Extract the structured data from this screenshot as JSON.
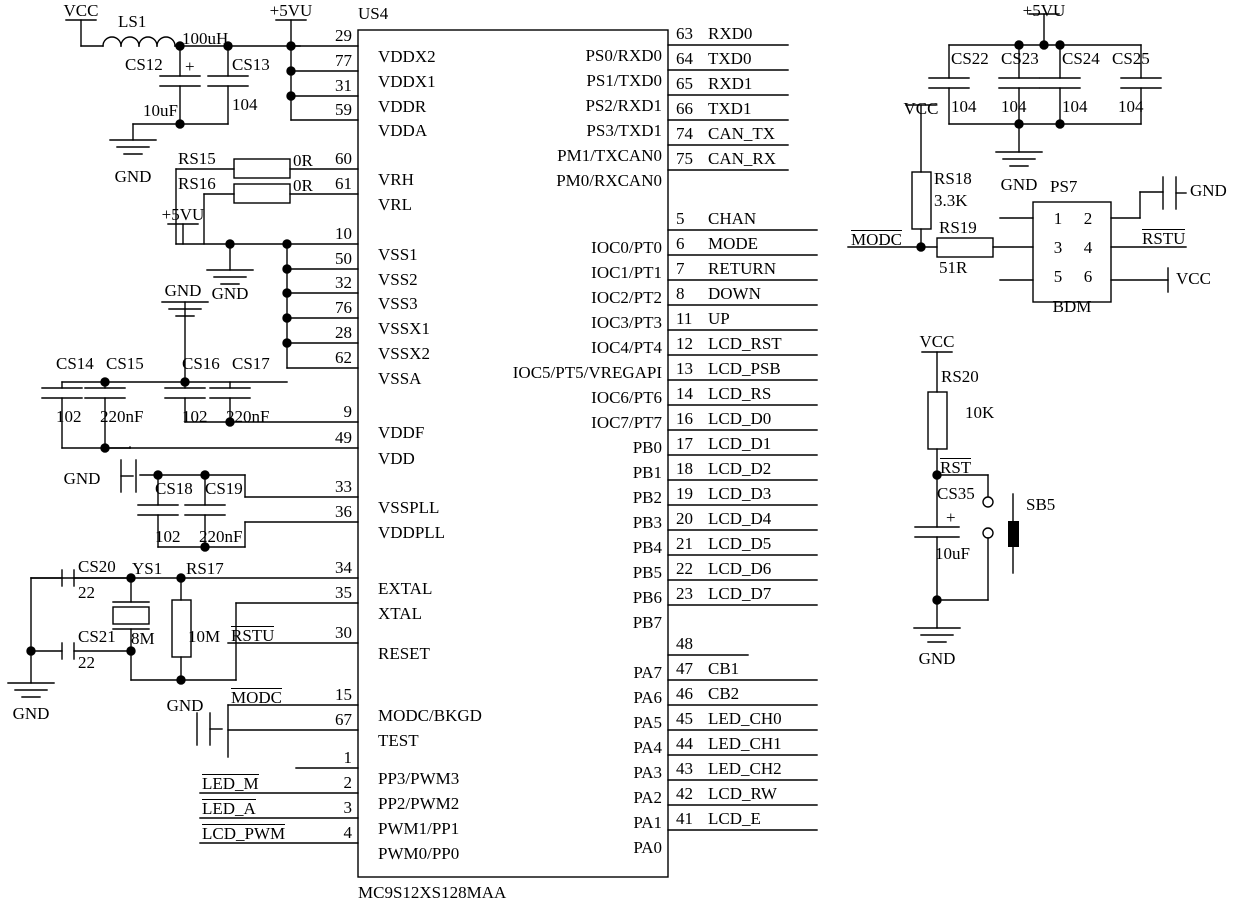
{
  "title": "MC9S12XS128MAA microcontroller schematic",
  "main_ic": {
    "ref": "US4",
    "part": "MC9S12XS128MAA",
    "left_pins": [
      {
        "num": "29",
        "name": "VDDX2"
      },
      {
        "num": "77",
        "name": "VDDX1"
      },
      {
        "num": "31",
        "name": "VDDR"
      },
      {
        "num": "59",
        "name": "VDDA"
      },
      {
        "num": "60",
        "name": "VRH"
      },
      {
        "num": "61",
        "name": "VRL"
      },
      {
        "num": "10",
        "name": "VSS1"
      },
      {
        "num": "50",
        "name": "VSS2"
      },
      {
        "num": "32",
        "name": "VSS3"
      },
      {
        "num": "76",
        "name": "VSSX1"
      },
      {
        "num": "28",
        "name": "VSSX2"
      },
      {
        "num": "62",
        "name": "VSSA"
      },
      {
        "num": "9",
        "name": "VDDF"
      },
      {
        "num": "49",
        "name": "VDD"
      },
      {
        "num": "33",
        "name": "VSSPLL"
      },
      {
        "num": "36",
        "name": "VDDPLL"
      },
      {
        "num": "34",
        "name": "EXTAL"
      },
      {
        "num": "35",
        "name": "XTAL"
      },
      {
        "num": "30",
        "name": "RESET",
        "overline": true,
        "net": "RSTU"
      },
      {
        "num": "15",
        "name": "MODC/BKGD",
        "net": "MODC"
      },
      {
        "num": "67",
        "name": "TEST"
      },
      {
        "num": "1",
        "name": "PP3/PWM3"
      },
      {
        "num": "2",
        "name": "PP2/PWM2",
        "net": "LED_M"
      },
      {
        "num": "3",
        "name": "PWM1/PP1",
        "net": "LED_A"
      },
      {
        "num": "4",
        "name": "PWM0/PP0",
        "net": "LCD_PWM"
      }
    ],
    "right_pins": [
      {
        "name": "PS0/RXD0",
        "num": "63",
        "net": "RXD0"
      },
      {
        "name": "PS1/TXD0",
        "num": "64",
        "net": "TXD0"
      },
      {
        "name": "PS2/RXD1",
        "num": "65",
        "net": "RXD1"
      },
      {
        "name": "PS3/TXD1",
        "num": "66",
        "net": "TXD1"
      },
      {
        "name": "PM1/TXCAN0",
        "num": "74",
        "net": "CAN_TX"
      },
      {
        "name": "PM0/RXCAN0",
        "num": "75",
        "net": "CAN_RX"
      },
      {
        "name": "IOC0/PT0",
        "num": "5",
        "net": "CHAN"
      },
      {
        "name": "IOC1/PT1",
        "num": "6",
        "net": "MODE"
      },
      {
        "name": "IOC2/PT2",
        "num": "7",
        "net": "RETURN"
      },
      {
        "name": "IOC3/PT3",
        "num": "8",
        "net": "DOWN"
      },
      {
        "name": "IOC4/PT4",
        "num": "11",
        "net": "UP"
      },
      {
        "name": "IOC5/PT5/VREGAPI",
        "num": "12",
        "net": "LCD_RST"
      },
      {
        "name": "IOC6/PT6",
        "num": "13",
        "net": "LCD_PSB"
      },
      {
        "name": "IOC7/PT7",
        "num": "14",
        "net": "LCD_RS"
      },
      {
        "name": "PB0",
        "num": "16",
        "net": "LCD_D0"
      },
      {
        "name": "PB1",
        "num": "17",
        "net": "LCD_D1"
      },
      {
        "name": "PB2",
        "num": "18",
        "net": "LCD_D2"
      },
      {
        "name": "PB3",
        "num": "19",
        "net": "LCD_D3"
      },
      {
        "name": "PB4",
        "num": "20",
        "net": "LCD_D4"
      },
      {
        "name": "PB5",
        "num": "21",
        "net": "LCD_D5"
      },
      {
        "name": "PB6",
        "num": "22",
        "net": "LCD_D6"
      },
      {
        "name": "PB7",
        "num": "23",
        "net": "LCD_D7"
      },
      {
        "name": "PA7",
        "num": "48",
        "net": ""
      },
      {
        "name": "PA6",
        "num": "47",
        "net": "CB1"
      },
      {
        "name": "PA5",
        "num": "46",
        "net": "CB2"
      },
      {
        "name": "PA4",
        "num": "45",
        "net": "LED_CH0"
      },
      {
        "name": "PA3",
        "num": "44",
        "net": "LED_CH1"
      },
      {
        "name": "PA2",
        "num": "43",
        "net": "LED_CH2"
      },
      {
        "name": "PA1",
        "num": "42",
        "net": "LCD_RW"
      },
      {
        "name": "PA0",
        "num": "41",
        "net": "LCD_E"
      }
    ]
  },
  "power_nets": {
    "vcc": "VCC",
    "v5vu": "+5VU",
    "gnd": "GND"
  },
  "components": {
    "ls1": {
      "ref": "LS1",
      "value": "100uH"
    },
    "cs12": {
      "ref": "CS12",
      "value": "10uF",
      "polarity": "+"
    },
    "cs13": {
      "ref": "CS13",
      "value": "104"
    },
    "rs15": {
      "ref": "RS15",
      "value": "0R"
    },
    "rs16": {
      "ref": "RS16",
      "value": "0R"
    },
    "cs14": {
      "ref": "CS14",
      "value": "102"
    },
    "cs15": {
      "ref": "CS15",
      "value": "220nF"
    },
    "cs16": {
      "ref": "CS16",
      "value": "102"
    },
    "cs17": {
      "ref": "CS17",
      "value": "220nF"
    },
    "cs18": {
      "ref": "CS18",
      "value": "102"
    },
    "cs19": {
      "ref": "CS19",
      "value": "220nF"
    },
    "cs20": {
      "ref": "CS20",
      "value": "22"
    },
    "cs21": {
      "ref": "CS21",
      "value": "22"
    },
    "ys1": {
      "ref": "YS1",
      "value": "8M"
    },
    "rs17": {
      "ref": "RS17",
      "value": "10M"
    },
    "cs22": {
      "ref": "CS22",
      "value": "104"
    },
    "cs23": {
      "ref": "CS23",
      "value": "104"
    },
    "cs24": {
      "ref": "CS24",
      "value": "104"
    },
    "cs25": {
      "ref": "CS25",
      "value": "104"
    },
    "rs18": {
      "ref": "RS18",
      "value": "3.3K"
    },
    "rs19": {
      "ref": "RS19",
      "value": "51R"
    },
    "rs20": {
      "ref": "RS20",
      "value": "10K"
    },
    "cs35": {
      "ref": "CS35",
      "value": "10uF",
      "polarity": "+"
    },
    "sb5": {
      "ref": "SB5"
    }
  },
  "bdm": {
    "ref": "PS7",
    "name": "BDM",
    "pins": [
      "1",
      "2",
      "3",
      "4",
      "5",
      "6"
    ],
    "pin2_net": "GND",
    "pin4_net": "RSTU",
    "pin6_net": "VCC",
    "pin3_net": "MODC"
  },
  "reset_net": {
    "label": "RST"
  },
  "nets": {
    "modc": "MODC",
    "rstu": "RSTU"
  },
  "colors": {
    "wire": "#000000",
    "background": "#ffffff"
  }
}
